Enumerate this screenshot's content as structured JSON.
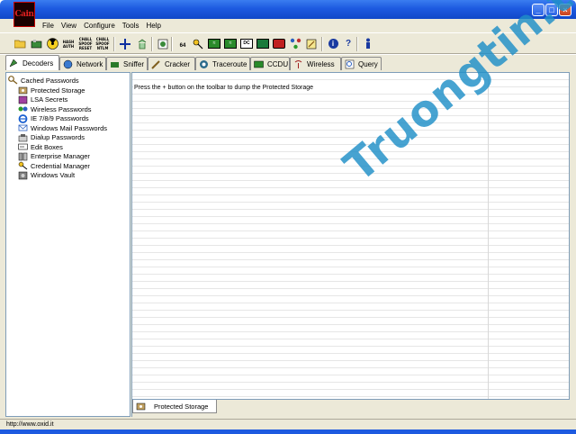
{
  "window": {
    "logo_text": "Cain",
    "controls": {
      "minimize": "_",
      "maximize": "□",
      "close": "×"
    }
  },
  "menu": [
    "File",
    "View",
    "Configure",
    "Tools",
    "Help"
  ],
  "toolbar": {
    "challenge_auth": "HASH AUTH",
    "challenge_spoof_reset": "CHALL SPOOF RESET",
    "challenge_spoof_ntlm": "CHALL SPOOF NTLM",
    "b64_label": "64",
    "ic_label": "DC",
    "info_label": "i",
    "help_label": "?"
  },
  "tabs": [
    {
      "label": "Decoders",
      "icon": "decoders-icon"
    },
    {
      "label": "Network",
      "icon": "network-icon"
    },
    {
      "label": "Sniffer",
      "icon": "sniffer-icon"
    },
    {
      "label": "Cracker",
      "icon": "cracker-icon"
    },
    {
      "label": "Traceroute",
      "icon": "traceroute-icon"
    },
    {
      "label": "CCDU",
      "icon": "ccdu-icon"
    },
    {
      "label": "Wireless",
      "icon": "wireless-icon"
    },
    {
      "label": "Query",
      "icon": "query-icon"
    }
  ],
  "tree": {
    "root": "Cached Passwords",
    "items": [
      "Protected Storage",
      "LSA Secrets",
      "Wireless Passwords",
      "IE 7/8/9 Passwords",
      "Windows Mail Passwords",
      "Dialup Passwords",
      "Edit Boxes",
      "Enterprise Manager",
      "Credential Manager",
      "Windows Vault"
    ]
  },
  "list": {
    "message": "Press the + button on the toolbar to dump the Protected Storage"
  },
  "bottom_tab": {
    "label": "Protected Storage"
  },
  "status": {
    "text": "http://www.oxid.it"
  },
  "watermark": {
    "text": "Truongtin.top"
  },
  "colors": {
    "titlebar": "#1d5ae0",
    "chrome": "#ece9d8",
    "watermark": "#1f8fc8"
  }
}
